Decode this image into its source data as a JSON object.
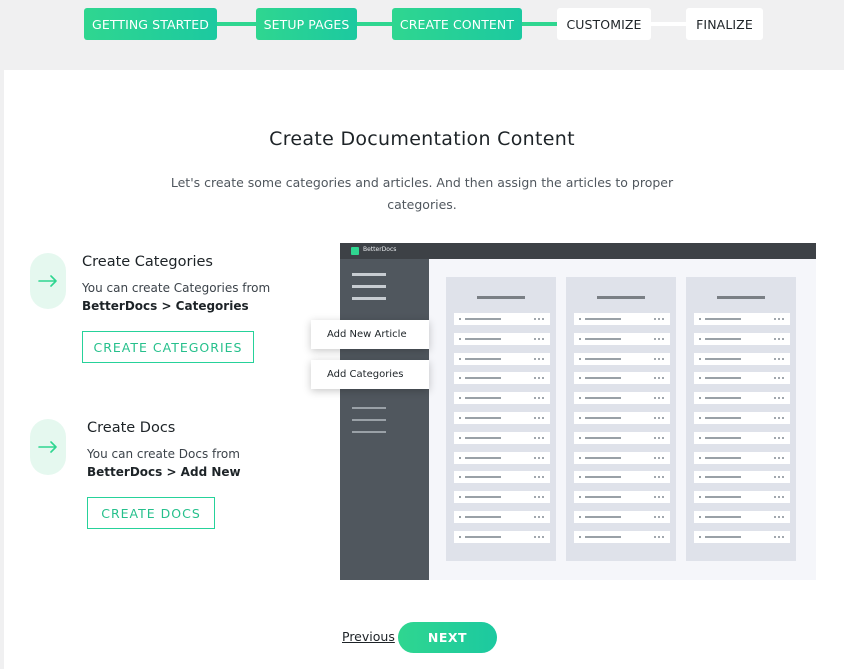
{
  "stepper": {
    "steps": [
      {
        "label": "GETTING STARTED",
        "state": "done"
      },
      {
        "label": "SETUP PAGES",
        "state": "done"
      },
      {
        "label": "CREATE CONTENT",
        "state": "active"
      },
      {
        "label": "CUSTOMIZE",
        "state": "todo"
      },
      {
        "label": "FINALIZE",
        "state": "todo"
      }
    ],
    "colors": {
      "done": "#2fd690",
      "todo": "#ffffff",
      "line_todo": "#ffffff"
    }
  },
  "main": {
    "title": "Create Documentation Content",
    "subtitle": "Let's create some categories and articles. And then assign the articles to proper categories."
  },
  "features": [
    {
      "title": "Create Categories",
      "desc_text": "You can create Categories from",
      "desc_path": "BetterDocs > Categories",
      "button_label": "CREATE CATEGORIES",
      "icon": "arrow-right-icon"
    },
    {
      "title": "Create Docs",
      "desc_text": "You can create Docs from",
      "desc_path": "BetterDocs > Add New",
      "button_label": "CREATE DOCS",
      "icon": "arrow-right-icon"
    }
  ],
  "illustration": {
    "brand": "BetterDocs",
    "menu_items": [
      "Add New Article",
      "Add Categories"
    ],
    "accent": "#2fd690"
  },
  "footer": {
    "previous_label": "Previous",
    "next_label": "NEXT"
  }
}
